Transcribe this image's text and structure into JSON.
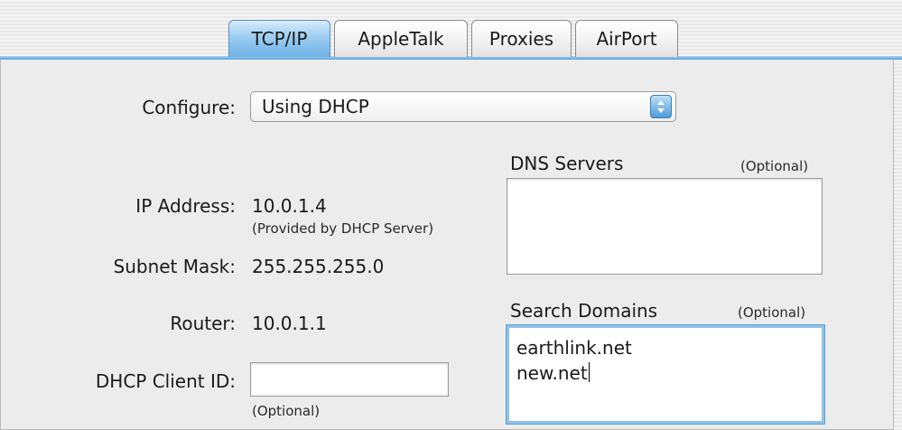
{
  "tabs": [
    {
      "label": "TCP/IP",
      "active": true
    },
    {
      "label": "AppleTalk",
      "active": false
    },
    {
      "label": "Proxies",
      "active": false
    },
    {
      "label": "AirPort",
      "active": false
    }
  ],
  "configure": {
    "label": "Configure:",
    "value": "Using DHCP"
  },
  "ip": {
    "label": "IP Address:",
    "value": "10.0.1.4",
    "hint": "(Provided by DHCP Server)"
  },
  "subnet": {
    "label": "Subnet Mask:",
    "value": "255.255.255.0"
  },
  "router": {
    "label": "Router:",
    "value": "10.0.1.1"
  },
  "dhcp_client": {
    "label": "DHCP Client ID:",
    "value": "",
    "hint": "(Optional)"
  },
  "dns": {
    "title": "DNS Servers",
    "hint": "(Optional)",
    "value": ""
  },
  "search_domains": {
    "title": "Search Domains",
    "hint": "(Optional)",
    "lines": [
      "earthlink.net",
      "new.net"
    ]
  },
  "colors": {
    "accent_tab": "#8ec6f0",
    "focus_ring": "#8fc1e8"
  }
}
